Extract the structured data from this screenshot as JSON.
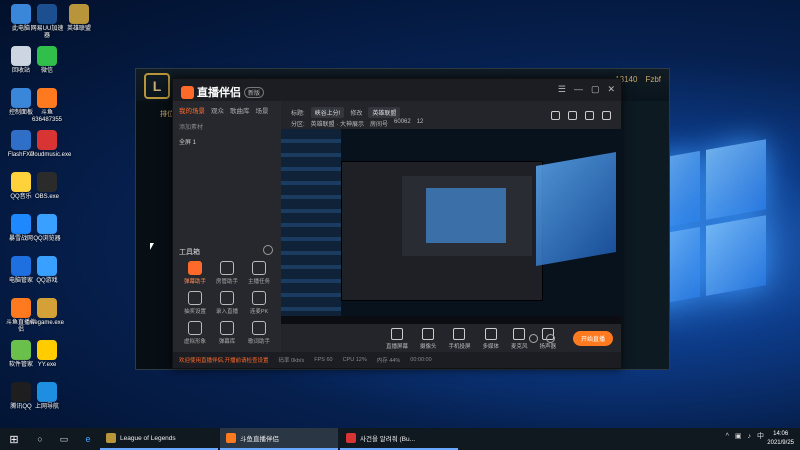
{
  "desktop": {
    "icons": [
      {
        "label": "此电脑",
        "color": "#3a86d8"
      },
      {
        "label": "网易UU加速器",
        "color": "#1b4f8f"
      },
      {
        "label": "英雄联盟",
        "color": "#b8953a"
      },
      {
        "label": "回收站",
        "color": "#cdd6e0"
      },
      {
        "label": "微信",
        "color": "#2fbf4a"
      },
      {
        "label": "控制面板",
        "color": "#3a86d8"
      },
      {
        "label": "斗鱼 636487355",
        "color": "#ff7a1f"
      },
      {
        "label": "FlashFXP",
        "color": "#2f6fc8"
      },
      {
        "label": "cloudmusic.exe",
        "color": "#d93434"
      },
      {
        "label": "QQ音乐",
        "color": "#ffd23c"
      },
      {
        "label": "OBS.exe",
        "color": "#2b2b2b"
      },
      {
        "label": "暴雪战网",
        "color": "#1e88ff"
      },
      {
        "label": "QQ浏览器",
        "color": "#3aa0ff"
      },
      {
        "label": "电脑管家",
        "color": "#1e6fe0"
      },
      {
        "label": "QQ游戏",
        "color": "#3aa0ff"
      },
      {
        "label": "斗鱼直播伴侣",
        "color": "#ff7a1f"
      },
      {
        "label": "wegame.exe",
        "color": "#d4a038"
      },
      {
        "label": "软件管家",
        "color": "#6ac04a"
      },
      {
        "label": "YY.exe",
        "color": "#ffcc00"
      },
      {
        "label": "腾讯QQ",
        "color": "#1e1e1e"
      },
      {
        "label": "上网导航",
        "color": "#1e8fe0"
      }
    ]
  },
  "lol": {
    "rp": "13140",
    "name": "Fzbf",
    "tab": "排位赛"
  },
  "app": {
    "title": "直播伴侣",
    "version": "新版",
    "left_tabs": [
      "我的场景",
      "观众",
      "歌曲库",
      "场景"
    ],
    "add_source": "添加素材",
    "scene": "全屏 1",
    "toolbox_title": "工具箱",
    "tools": [
      {
        "label": "弹幕助手",
        "hl": true
      },
      {
        "label": "房管助手",
        "hl": false
      },
      {
        "label": "主播任务",
        "hl": false
      },
      {
        "label": "抽奖设置",
        "hl": false
      },
      {
        "label": "录入直播",
        "hl": false
      },
      {
        "label": "连麦PK",
        "hl": false
      },
      {
        "label": "虚拟形象",
        "hl": false
      },
      {
        "label": "弹幕库",
        "hl": false
      },
      {
        "label": "歌词助手",
        "hl": false
      }
    ],
    "info": {
      "title_label": "标题:",
      "title_value": "峡谷上分!",
      "edit": "修改",
      "category": "英雄联盟",
      "area_label": "分区:",
      "area": "英雄联盟 · 大神展示",
      "room_label": "房间号",
      "room": "60062",
      "viewers": "12"
    },
    "controls": [
      "直播屏幕",
      "摄像头",
      "手机投屏",
      "多媒体",
      "麦克风",
      "扬声器"
    ],
    "live_button": "开始直播",
    "status": {
      "warn": "欢迎使用直播伴侣,开播前请检查设置",
      "bitrate": "码率 0kb/s",
      "fps": "FPS 60",
      "cpu": "CPU 12%",
      "mem": "内存 44%",
      "time": "00:00:00"
    }
  },
  "taskbar": {
    "apps": [
      {
        "label": "League of Legends",
        "color": "#b8953a"
      },
      {
        "label": "斗鱼直播伴侣",
        "color": "#ff7a1f"
      },
      {
        "label": "사건을 알려줘 (Bu...",
        "color": "#d93434"
      }
    ],
    "time": "14:06",
    "date": "2021/9/25"
  }
}
